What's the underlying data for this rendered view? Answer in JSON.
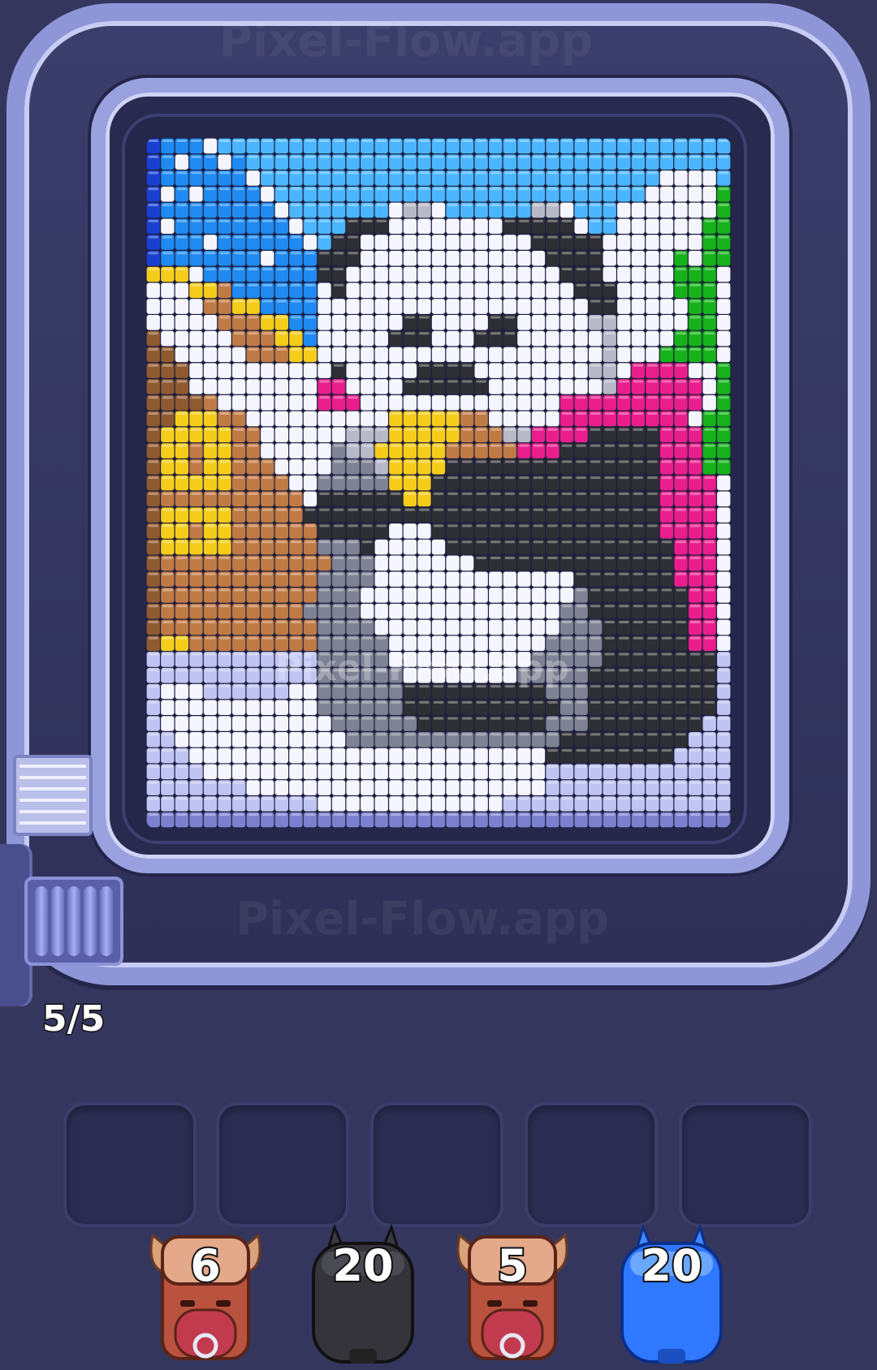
{
  "game": {
    "watermark_top": "Pixel-Flow.app",
    "watermark_bottom": "Pixel-Flow.app",
    "board_watermark": "Pixel-Flow.app",
    "conveyor_counter": "5/5"
  },
  "slots": {
    "count": 5
  },
  "shooters": [
    {
      "id": "shooter-1",
      "type": "bull",
      "count": "6",
      "color": "#c6806a"
    },
    {
      "id": "shooter-2",
      "type": "cat",
      "count": "20",
      "color": "#3a3a40"
    },
    {
      "id": "shooter-3",
      "type": "bull",
      "count": "5",
      "color": "#c6806a"
    },
    {
      "id": "shooter-4",
      "type": "cat",
      "count": "20",
      "color": "#2f78ff"
    }
  ],
  "palette": {
    "a": "#1a3fd0",
    "b": "#1f8af2",
    "l": "#4bb6ff",
    "w": "#f4f5ff",
    "p": "#bfc4f2",
    "q": "#7b80cf",
    "k": "#2e2f35",
    "g": "#7f8294",
    "m": "#b8b9c8",
    "o": "#8f5a30",
    "r": "#c07a45",
    "y": "#f6cc1a",
    "n": "#e91e8c",
    "e": "#16b21a"
  },
  "pixel_rows": [
    "abbbwllllllllllllllllllllllllllllllllllll",
    "abwbbwbllllllllllllllllllllllllllllllllll",
    "abbbbbbwllllllllllllllllllllllllllllwwwwl",
    "awbwbbbbwllllllllllllllllllllllllllwwwwwe",
    "abbbbbbbbwlllllllwmmwllllllmmwlllwwwwwwwe",
    "awbbbbbbbbwlllkkkwwwwwwwwkkkkkwllwwwwwwee",
    "abbbwbbbbbbwlkkwwwwwwwwwwwwkkkkkwwwwwwwee",
    "abbbbbbbwbbbkkkwwwwwwwwwwwwwkkkkwwwwwewee",
    "yyywbbbbbbbbkkwwwwwwwwwwwwwwwkkkwwwwweeew",
    "wwwyyrbbbbbbwkwwwwwwwwwwwwwwwwkkkwwwweeew",
    "wwwwrryybbbbwwwwwwwwwwwwwwwwwwwkkwwwwweew",
    "wwwwwrrryybbwwwwwwkkwwwwkkwwwwwmmwwwwweew",
    "owwwwwrrryybwwwwwkkkwwwkkkwwwwwwmwwwweeew",
    "oowwwwwrrryywwwwwwwwwwwwwwwwwwwwmwwweeeew",
    "ooowwwwwwwwwwkwwwwwkkkkwwwwwwwwmmwnnnnwwe",
    "ooowwwwwwwwwnnwwwwkkkkkkwwwwwwwwmnnnnnnwe",
    "oooorwwwwwwwnnnwwwwwwwwwwwwwwnnnnnnnnnnwe",
    "ooyyyrrwwwwwwwwwwyyyyyrrwwwwwnnnnnnnnnwee",
    "oyyyyyrrwwwwwwmmmyyyyyrrrmmnnnnkkkkknnnee",
    "oyyryyrrwwwwwgmmyyyyyrrrrrnnnkkkkkkknnnee",
    "oyyryyrrrwwwwgggmyyyykkkkkkkkkkkkkkknnnee",
    "oyyyyyrrrrwwgggggyyykkkkkkkkkkkkkkkknnnnw",
    "orrrrrrrrrrwkkkkkkyykkkkkkkkkkkkkkkknnnnw",
    "oyyyyyrrrrrkkkkkkkkkkkkkkkkkkkkkkkkknnnnw",
    "oyyryyrrrrrrkkkkkwwwkkkkkkkkkkkkkkkknnnnw",
    "oyyyyyrrrrrrgggkwwwwwkkkkkkkkkkkkkkkknnnw",
    "orrrrrrrrrrrrgggwwwwwwwkkkkkkkkkkkkkknnnw",
    "orrrrrrrrrrrggggwwwwwwwwwwwwwwkkkkkkknnnw",
    "orrrrrrrrrrrgggwwwwwwwwwwwwwwwgkkkkkkknnw",
    "orrrrrrrrrrggggwwwwwwwwwwwwwwggkkkkkkknnw",
    "orrrrrrrrrrrggggwwwwwwwwwwwwwgggkkkkkknnw",
    "oyyrrrrrrrrrgggggwwwwwwwwwwwggggkkkkkknnw",
    "ppppppppppppgggggwwwwwwwwwwgggggkkkkkkkkp",
    "ppppppppppppggggggwwwwwwwwgggggkkkkkkkkkp",
    "pwwwppppppwwggggggkkkkkkkkkkgggkkkkkkkkkp",
    "pwwwwwwwwwwwggggggkkkkkkkkkkkggkkkkkkkkkp",
    "pwwwwwwwwwwwwggggggkkkkkkkkkgggkkkkkkkkpp",
    "ppwwwwwwwwwwwwgggggggggggggggkkkkkkkkkppp",
    "pppwwwwwwwwwwwwwwwwwwwwwwwwwkkkkkkkkkpppp",
    "ppppwwwwwwwwwwwwwwwwwwwwwwwwpppppppppppp",
    "pppppppwwwwwwwwwwwwwwwwwwwwwppppppppppppp",
    "ppppppppppppwwwwwwwwwwwwwpppppppppppppppp",
    "qqqqqqqqqqqqqqqqqqqqqqqqqqqqqqqqqqqqqqqqq"
  ]
}
